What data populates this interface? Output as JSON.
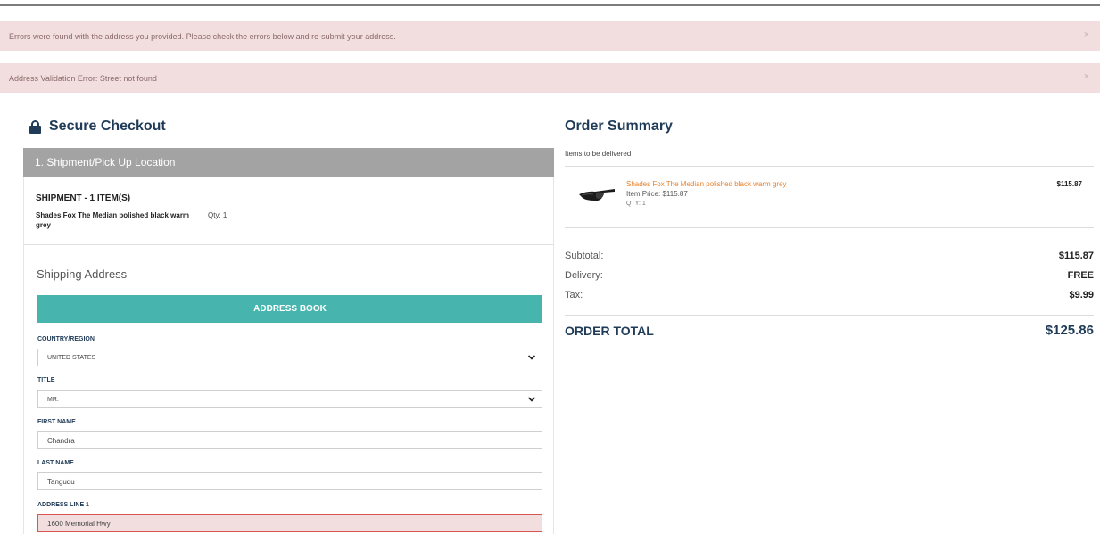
{
  "alerts": [
    {
      "message": "Errors were found with the address you provided. Please check the errors below and re-submit your address.",
      "close": "×"
    },
    {
      "message": "Address Validation Error: Street not found",
      "close": "×"
    }
  ],
  "checkout": {
    "title": "Secure Checkout",
    "step_header": "1. Shipment/Pick Up Location",
    "shipment_title": "SHIPMENT - 1 ITEM(S)",
    "item_name": "Shades Fox The Median polished black warm grey",
    "item_qty": "Qty: 1",
    "shipping_address_title": "Shipping Address",
    "address_book_label": "ADDRESS BOOK",
    "fields": {
      "country": {
        "label": "COUNTRY/REGION",
        "value": "UNITED STATES"
      },
      "title": {
        "label": "TITLE",
        "value": "MR."
      },
      "first_name": {
        "label": "FIRST NAME",
        "value": "Chandra"
      },
      "last_name": {
        "label": "LAST NAME",
        "value": "Tangudu"
      },
      "address1": {
        "label": "ADDRESS LINE 1",
        "value": "1600  Memorial Hwy"
      }
    }
  },
  "summary": {
    "title": "Order Summary",
    "items_label": "Items to be delivered",
    "product": {
      "name": "Shades Fox The Median polished black warm grey",
      "price": "Item Price:  $115.87",
      "qty": "QTY:  1",
      "total": "$115.87"
    },
    "subtotal_label": "Subtotal:",
    "subtotal_value": "$115.87",
    "delivery_label": "Delivery:",
    "delivery_value": "FREE",
    "tax_label": "Tax:",
    "tax_value": "$9.99",
    "total_label": "ORDER TOTAL",
    "total_value": "$125.86"
  },
  "colors": {
    "accent": "#47b5ad",
    "heading": "#1f3b57",
    "alert_bg": "#f2dede",
    "product_link": "#e8812b",
    "error_border": "#d9534f"
  },
  "icons": [
    "lock-icon",
    "close-icon",
    "chevron-down-icon",
    "sunglasses-image"
  ]
}
